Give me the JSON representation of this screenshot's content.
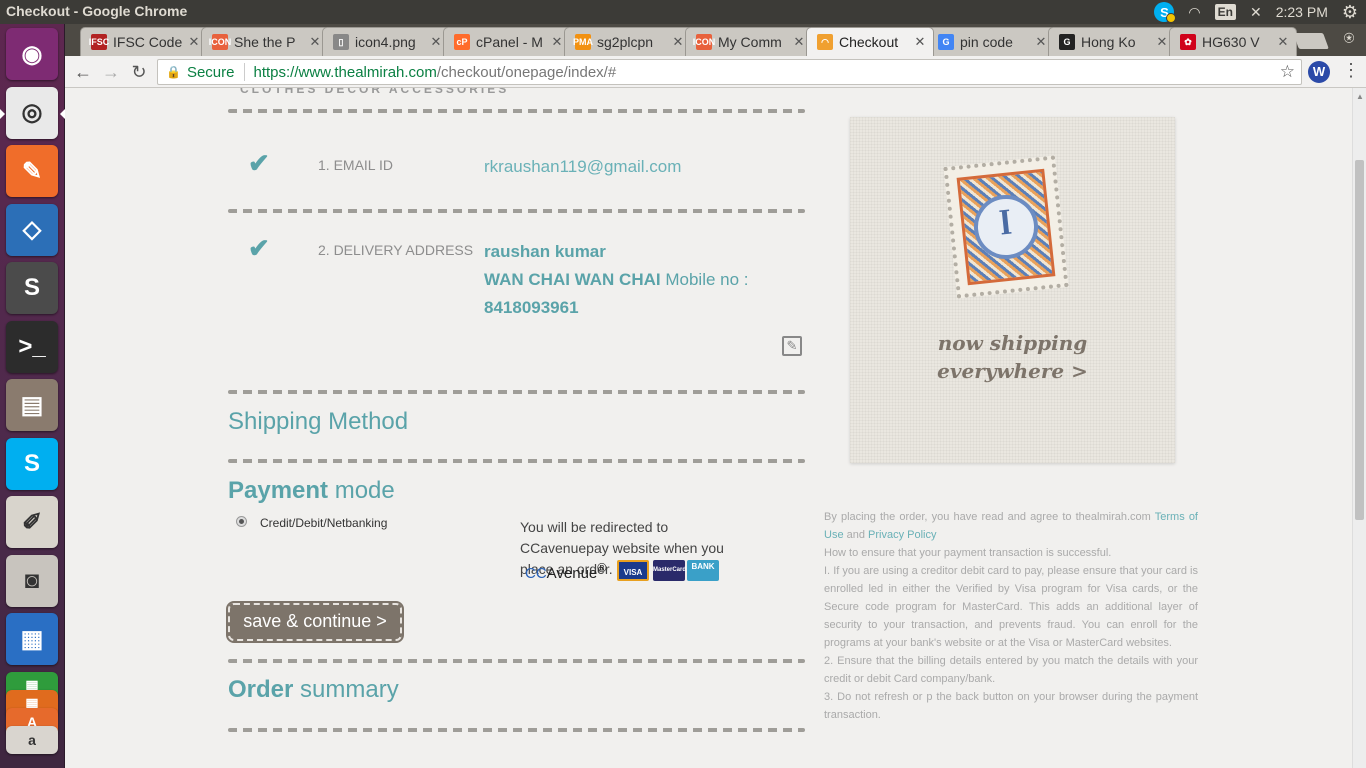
{
  "system": {
    "window_title": "Checkout - Google Chrome",
    "lang_indicator": "En",
    "clock": "2:23 PM"
  },
  "launcher": [
    {
      "name": "ubuntu-dash",
      "glyph": "◉",
      "color": "#7e2b73"
    },
    {
      "name": "chrome",
      "glyph": "◎",
      "color": "#e9e9e9"
    },
    {
      "name": "postman",
      "glyph": "✎",
      "color": "#f06d2a"
    },
    {
      "name": "virtualbox",
      "glyph": "◇",
      "color": "#2c6fb7"
    },
    {
      "name": "sublime-text",
      "glyph": "S",
      "color": "#4b4b4b"
    },
    {
      "name": "terminal",
      "glyph": ">_",
      "color": "#2c2c2c"
    },
    {
      "name": "file-manager",
      "glyph": "▤",
      "color": "#8a7b6e"
    },
    {
      "name": "skype",
      "glyph": "S",
      "color": "#00aff0"
    },
    {
      "name": "text-editor",
      "glyph": "✐",
      "color": "#d8d4cc"
    },
    {
      "name": "camera",
      "glyph": "◙",
      "color": "#c8c4be"
    },
    {
      "name": "libreoffice-writer",
      "glyph": "▦",
      "color": "#2a6fc4"
    },
    {
      "name": "libreoffice-calc",
      "glyph": "▦",
      "color": "#2f9c3c"
    },
    {
      "name": "libreoffice-impress",
      "glyph": "▦",
      "color": "#e06b1e"
    },
    {
      "name": "software-center",
      "glyph": "A",
      "color": "#e66a2c"
    },
    {
      "name": "amazon",
      "glyph": "a",
      "color": "#d9d5cf"
    }
  ],
  "tabs": [
    {
      "label": "IFSC Code",
      "fav_text": "IFSC",
      "fav_color": "#b22222"
    },
    {
      "label": "She the P",
      "fav_text": "ICON",
      "fav_color": "#e8613c"
    },
    {
      "label": "icon4.png",
      "fav_text": "▯",
      "fav_color": "#888888"
    },
    {
      "label": "cPanel - M",
      "fav_text": "cP",
      "fav_color": "#ff6c2c"
    },
    {
      "label": "sg2plcpn",
      "fav_text": "PMA",
      "fav_color": "#f29111"
    },
    {
      "label": "My Comm",
      "fav_text": "ICON",
      "fav_color": "#e8613c"
    },
    {
      "label": "Checkout",
      "fav_text": "◠",
      "fav_color": "#f0a030"
    },
    {
      "label": "pin code",
      "fav_text": "G",
      "fav_color": "#4285f4"
    },
    {
      "label": "Hong Ko",
      "fav_text": "G",
      "fav_color": "#222222"
    },
    {
      "label": "HG630 V",
      "fav_text": "✿",
      "fav_color": "#d0021b"
    }
  ],
  "toolbar": {
    "secure_label": "Secure",
    "url_host": "https://www.thealmirah.com",
    "url_path": "/checkout/onepage/index/#"
  },
  "checkout": {
    "top_cut_text": "CLOTHES  DECOR  ACCESSORIES",
    "step1_label": "1. EMAIL ID",
    "step1_value": "rkraushan119@gmail.com",
    "step2_label": "2. DELIVERY ADDRESS",
    "address_name": "raushan kumar",
    "address_line": "WAN CHAI WAN CHAI",
    "mobile_label": "Mobile no :",
    "mobile_number": "8418093961",
    "shipping_heading": "Shipping Method",
    "payment_heading_bold": "Payment",
    "payment_heading_rest": " mode",
    "payment_option": "Credit/Debit/Netbanking",
    "redirect_text": "You will be redirected to CCavenuepay website when you place an order.",
    "ccavenue_cc": "CC",
    "ccavenue_rest": "Avenue",
    "card_visa": "VISA",
    "card_master": "MasterCard",
    "card_bank": "BANK",
    "save_button": "save & continue >",
    "order_heading_bold": "Order",
    "order_heading_rest": " summary"
  },
  "promo": {
    "stamp_glyph": "ꟾ",
    "line1": "now shipping",
    "line2": "everywhere >"
  },
  "terms": {
    "intro": "By placing the order, you have read and agree to thealmirah.com ",
    "link1": "Terms of Use",
    "and": " and ",
    "link2": "Privacy Policy",
    "how": "How to ensure that your payment transaction is successful.",
    "p1": "I. If you are using a creditor debit card to pay, please ensure that your card is enrolled led in either the Verified by Visa program for Visa cards, or the Secure code program for MasterCard. This adds an additional layer of security to your transaction, and prevents fraud. You can enroll for the programs at your bank's website or at the Visa or MasterCard websites.",
    "p2": "2. Ensure that the billing details entered by you match the details with your credit or debit Card company/bank.",
    "p3": "3. Do not refresh or p the back button on your browser during the payment transaction."
  }
}
